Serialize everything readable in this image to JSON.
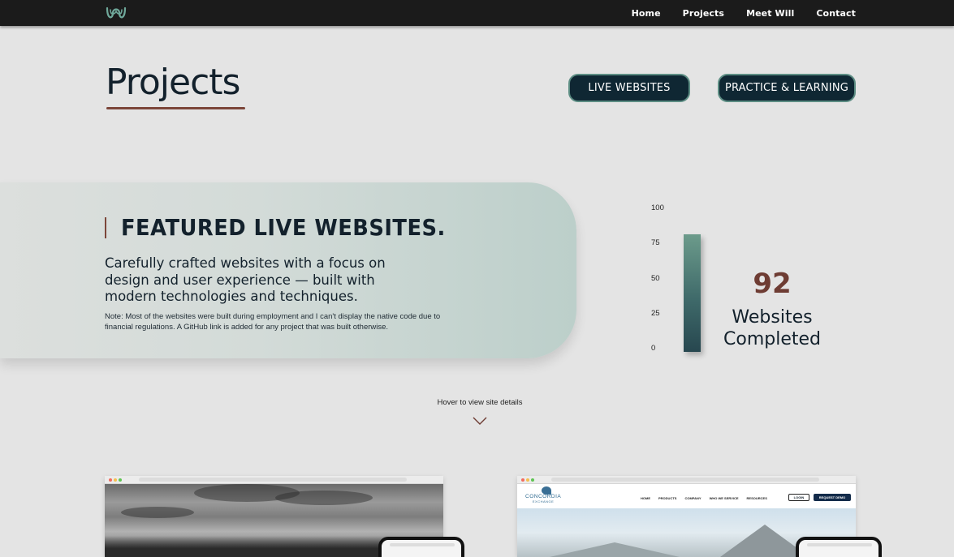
{
  "nav": {
    "logo_icon": "wave-w-logo-icon",
    "items": [
      {
        "label": "Home"
      },
      {
        "label": "Projects"
      },
      {
        "label": "Meet Will"
      },
      {
        "label": "Contact"
      }
    ]
  },
  "header": {
    "title": "Projects",
    "buttons": {
      "live": "LIVE WEBSITES",
      "practice": "PRACTICE & LEARNING"
    }
  },
  "featured": {
    "heading": "FEATURED LIVE WEBSITES.",
    "description": "Carefully crafted websites with a focus on design and user experience — built with modern technologies and techniques.",
    "note": "Note: Most of the websites were built during employment and I can't display the native code due to financial regulations. A GitHub link is added for any project that was built otherwise."
  },
  "gauge": {
    "ticks": [
      "100",
      "75",
      "50",
      "25",
      "0"
    ],
    "value_percent": 92,
    "stat_number": "92",
    "stat_label_line1": "Websites",
    "stat_label_line2": "Completed"
  },
  "hint": {
    "text": "Hover to view site details",
    "icon": "chevron-down-icon"
  },
  "projects": [
    {
      "screenshot": "golf-site-screenshot"
    },
    {
      "screenshot": "concordia-exchange-screenshot",
      "logo_text": "CONCORDIA",
      "logo_subtext": "EXCHANGE",
      "nav_links": [
        "HOME",
        "PRODUCTS",
        "COMPANY",
        "WHO WE SERVICE",
        "RESOURCES"
      ],
      "login": "LOGIN",
      "demo": "REQUEST DEMO"
    }
  ],
  "colors": {
    "nav_bg": "#1b1b1b",
    "page_bg": "#e4e4e4",
    "accent_brown": "#7c4639",
    "button_bg": "#0f2733",
    "teal": "#5c8d83"
  }
}
